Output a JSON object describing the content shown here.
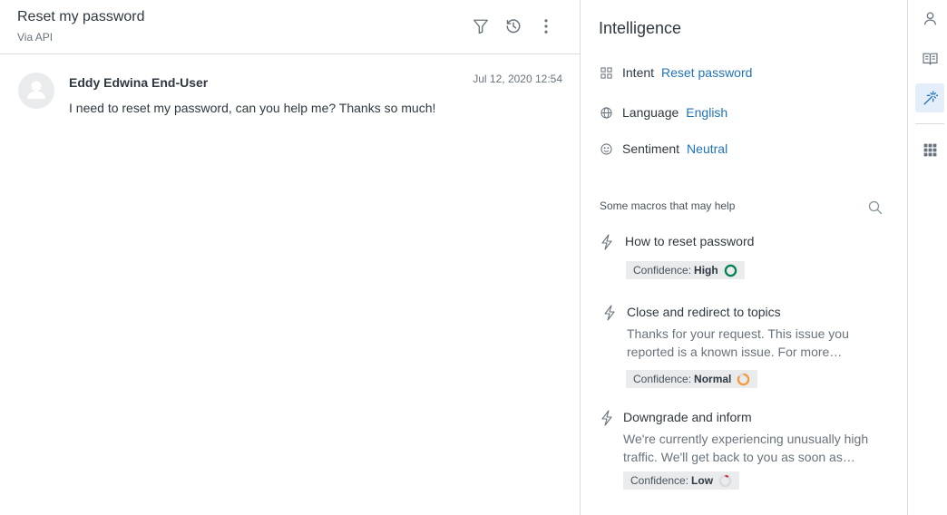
{
  "ticket": {
    "title": "Reset my password",
    "channel": "Via API"
  },
  "header_icons": [
    "filter-icon",
    "history-icon",
    "more-options-icon"
  ],
  "message": {
    "author": "Eddy Edwina End-User",
    "timestamp": "Jul 12, 2020 12:54",
    "body": "I need to reset my password, can you help me? Thanks so much!"
  },
  "intelligence": {
    "title": "Intelligence",
    "intent_label": "Intent",
    "intent_value": "Reset password",
    "language_label": "Language",
    "language_value": "English",
    "sentiment_label": "Sentiment",
    "sentiment_value": "Neutral"
  },
  "macros": {
    "heading": "Some macros that may help",
    "items": [
      {
        "title": "How to reset password",
        "description": "",
        "confidence_label": "Confidence:",
        "confidence_level": "High",
        "confidence_color": "#038153",
        "confidence_fraction": 1.0
      },
      {
        "title": "Close and redirect to topics",
        "description": "Thanks for your request. This issue you reported is a known issue. For more…",
        "confidence_label": "Confidence:",
        "confidence_level": "Normal",
        "confidence_color": "#f79a3e",
        "confidence_fraction": 0.85
      },
      {
        "title": "Downgrade and inform",
        "description": "We're currently experiencing unusually high traffic. We'll get back to you as soon as…",
        "confidence_label": "Confidence:",
        "confidence_level": "Low",
        "confidence_color": "#cc3340",
        "confidence_fraction": 0.1
      }
    ]
  },
  "rail_icons": [
    "user-icon",
    "knowledge-book-icon",
    "magic-wand-icon",
    "apps-grid-icon"
  ],
  "colors": {
    "link": "#1f73b7",
    "active_rail_bg": "#e4eefa",
    "border": "#d8dcde"
  }
}
